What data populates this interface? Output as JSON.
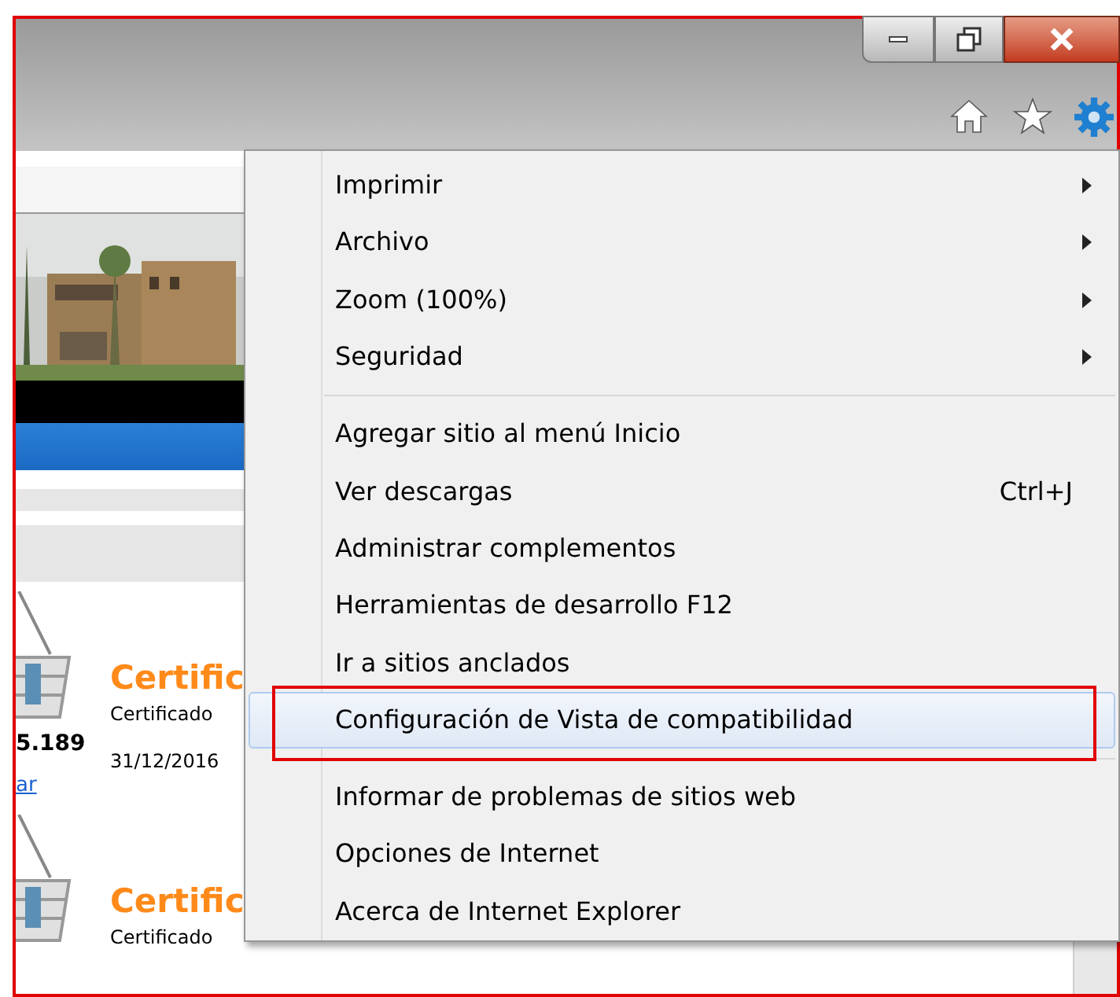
{
  "page": {
    "cards": [
      {
        "title": "Certific",
        "subtitle": "Certificado",
        "price": "5.189",
        "date": "31/12/2016",
        "link": "ar"
      },
      {
        "title": "Certific",
        "subtitle": "Certificado"
      }
    ]
  },
  "menu": {
    "items": [
      {
        "kind": "submenu",
        "label": "Imprimir",
        "selected": false
      },
      {
        "kind": "submenu",
        "label": "Archivo",
        "selected": false
      },
      {
        "kind": "submenu",
        "label": "Zoom (100%)",
        "selected": false
      },
      {
        "kind": "submenu",
        "label": "Seguridad",
        "selected": false
      },
      {
        "kind": "separator"
      },
      {
        "kind": "item",
        "label": "Agregar sitio al menú Inicio",
        "selected": false
      },
      {
        "kind": "item",
        "label": "Ver descargas",
        "shortcut": "Ctrl+J",
        "selected": false
      },
      {
        "kind": "item",
        "label": "Administrar complementos",
        "selected": false
      },
      {
        "kind": "item",
        "label": "Herramientas de desarrollo F12",
        "selected": false
      },
      {
        "kind": "item",
        "label": "Ir a sitios anclados",
        "selected": false
      },
      {
        "kind": "item",
        "label": "Configuración de Vista de compatibilidad",
        "selected": true
      },
      {
        "kind": "separator"
      },
      {
        "kind": "item",
        "label": "Informar de problemas de sitios web",
        "selected": false
      },
      {
        "kind": "item",
        "label": "Opciones de Internet",
        "selected": false
      },
      {
        "kind": "item",
        "label": "Acerca de Internet Explorer",
        "selected": false
      }
    ]
  }
}
